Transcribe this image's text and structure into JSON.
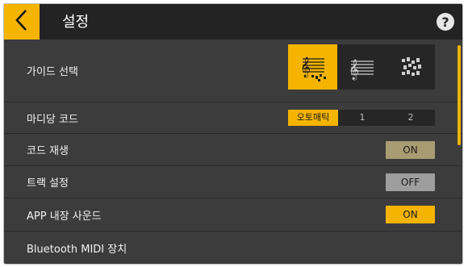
{
  "header": {
    "title": "설정",
    "back_icon": "chevron-left-icon",
    "help_label": "?"
  },
  "settings": {
    "guide": {
      "label": "가이드 선택",
      "options": [
        "staff-with-blocks-icon",
        "staff-icon",
        "blocks-icon"
      ],
      "selected_index": 0
    },
    "madi_chord": {
      "label": "마디당 코드",
      "options": [
        "오토매틱",
        "1",
        "2"
      ],
      "selected_index": 0
    },
    "chord_play": {
      "label": "코드 재생",
      "value": "ON"
    },
    "track_setting": {
      "label": "트랙 설정",
      "value": "OFF"
    },
    "app_sound": {
      "label": "APP 내장 사운드",
      "value": "ON"
    },
    "bluetooth_midi": {
      "label": "Bluetooth MIDI 장치"
    }
  },
  "colors": {
    "accent": "#f4b400",
    "header_bg": "#232323",
    "list_bg": "#3c3c3c",
    "toggle_on_dim": "#a89c72",
    "toggle_off": "#9e9e9e"
  }
}
